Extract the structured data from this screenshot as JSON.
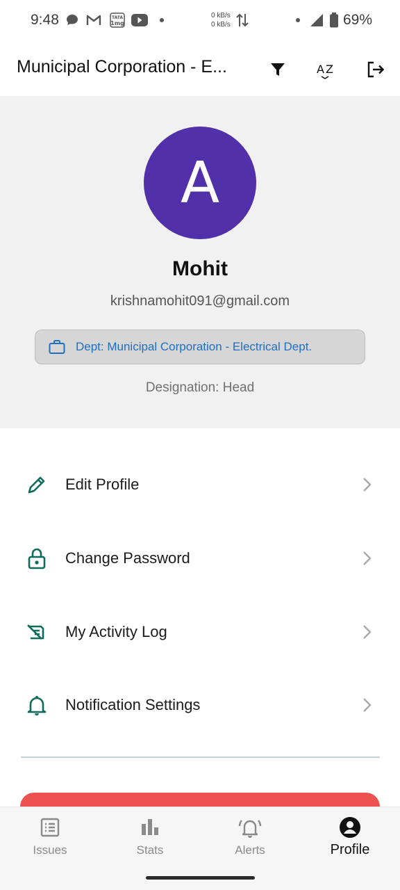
{
  "status_bar": {
    "time": "9:48",
    "net_speed_up": "0 kB/s",
    "net_speed_down": "0 kB/s",
    "battery": "69%",
    "icons": [
      "chat-icon",
      "gmail-icon",
      "tata-1mg-icon",
      "youtube-icon",
      "dot",
      "data-arrows-icon",
      "signal-icon",
      "battery-icon"
    ]
  },
  "app_bar": {
    "title": "Municipal Corporation - E...",
    "actions": [
      "filter-icon",
      "sort-az-icon",
      "logout-icon"
    ]
  },
  "profile": {
    "avatar_letter": "A",
    "name": "Mohit",
    "email": "krishnamohit091@gmail.com",
    "department": "Dept: Municipal Corporation - Electrical Dept.",
    "designation": "Designation: Head"
  },
  "menu": [
    {
      "label": "Edit Profile",
      "icon": "pencil-icon"
    },
    {
      "label": "Change Password",
      "icon": "lock-icon"
    },
    {
      "label": "My Activity Log",
      "icon": "activity-log-icon"
    },
    {
      "label": "Notification Settings",
      "icon": "bell-icon"
    }
  ],
  "bottom_nav": [
    {
      "label": "Issues",
      "icon": "list-icon",
      "active": false
    },
    {
      "label": "Stats",
      "icon": "bar-chart-icon",
      "active": false
    },
    {
      "label": "Alerts",
      "icon": "alarm-icon",
      "active": false
    },
    {
      "label": "Profile",
      "icon": "account-circle-icon",
      "active": true
    }
  ],
  "colors": {
    "avatar": "#5230aa",
    "accent_teal": "#0f6b5c",
    "dept_text": "#1f6fc0",
    "logout": "#ec5250"
  }
}
